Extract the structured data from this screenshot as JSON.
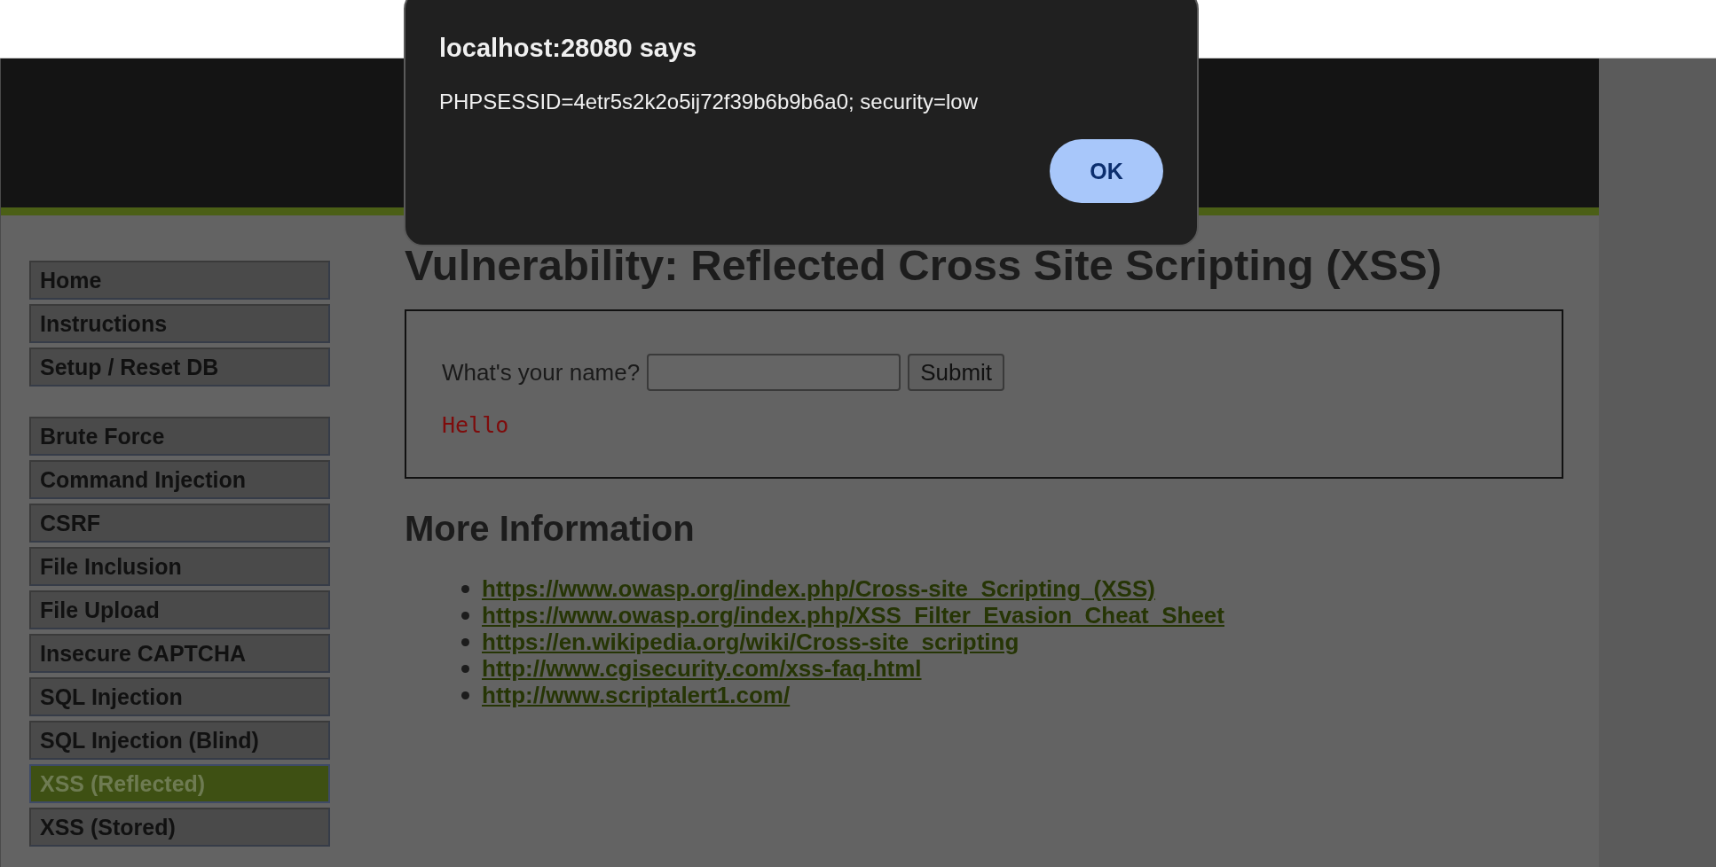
{
  "dialog": {
    "title": "localhost:28080 says",
    "message": "PHPSESSID=4etr5s2k2o5ij72f39b6b9b6a0; security=low",
    "button": "OK"
  },
  "sidebar": {
    "groups": [
      {
        "items": [
          {
            "label": "Home",
            "selected": false
          },
          {
            "label": "Instructions",
            "selected": false
          },
          {
            "label": "Setup / Reset DB",
            "selected": false
          }
        ]
      },
      {
        "items": [
          {
            "label": "Brute Force",
            "selected": false
          },
          {
            "label": "Command Injection",
            "selected": false
          },
          {
            "label": "CSRF",
            "selected": false
          },
          {
            "label": "File Inclusion",
            "selected": false
          },
          {
            "label": "File Upload",
            "selected": false
          },
          {
            "label": "Insecure CAPTCHA",
            "selected": false
          },
          {
            "label": "SQL Injection",
            "selected": false
          },
          {
            "label": "SQL Injection (Blind)",
            "selected": false
          },
          {
            "label": "XSS (Reflected)",
            "selected": true
          },
          {
            "label": "XSS (Stored)",
            "selected": false
          }
        ]
      }
    ]
  },
  "main": {
    "title": "Vulnerability: Reflected Cross Site Scripting (XSS)",
    "form": {
      "label": "What's your name?",
      "button": "Submit",
      "output": "Hello"
    },
    "more_info": {
      "heading": "More Information",
      "links": [
        "https://www.owasp.org/index.php/Cross-site_Scripting_(XSS)",
        "https://www.owasp.org/index.php/XSS_Filter_Evasion_Cheat_Sheet",
        "https://en.wikipedia.org/wiki/Cross-site_scripting",
        "http://www.cgisecurity.com/xss-faq.html",
        "http://www.scriptalert1.com/"
      ]
    }
  }
}
